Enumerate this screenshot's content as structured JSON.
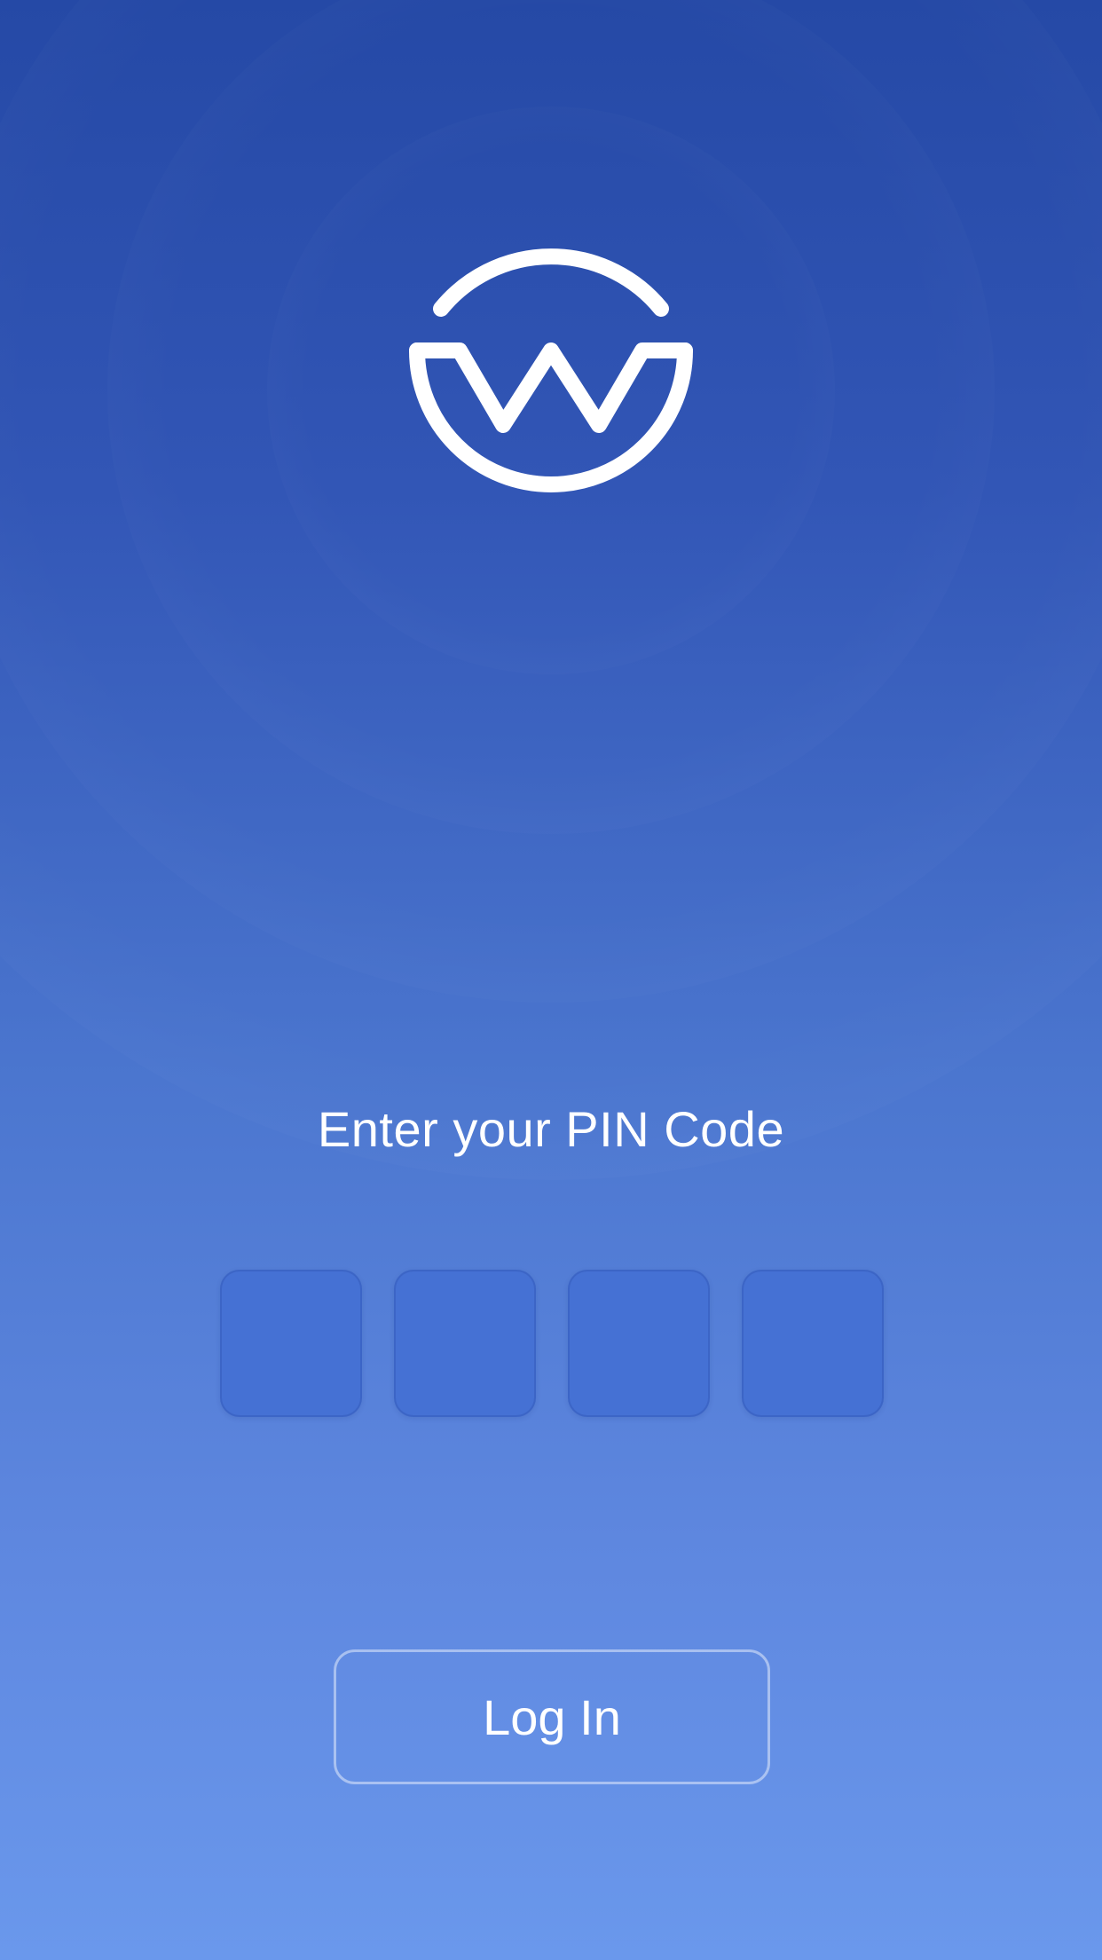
{
  "login": {
    "prompt": "Enter your PIN Code",
    "pin_length": 4,
    "pin_digits": [
      "",
      "",
      "",
      ""
    ],
    "button_label": "Log In"
  },
  "logo": {
    "icon": "w-circle-logo"
  },
  "colors": {
    "background_top": "#2549a6",
    "background_bottom": "#6a98ec",
    "pin_box": "#4571d4",
    "text": "#ffffff"
  }
}
